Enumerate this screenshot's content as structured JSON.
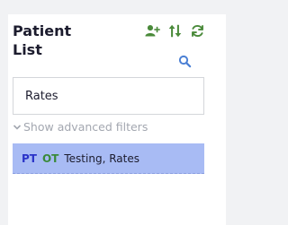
{
  "header": {
    "title_line1": "Patient",
    "title_line2": "List"
  },
  "search": {
    "value": "Rates"
  },
  "filters": {
    "toggle_label": "Show advanced filters"
  },
  "results": [
    {
      "tag1": "PT",
      "tag2": "OT",
      "name": "Testing, Rates"
    }
  ],
  "colors": {
    "accent_green": "#4a8a3a",
    "accent_blue": "#4a7fd4",
    "row_highlight": "#a8bbf4"
  }
}
